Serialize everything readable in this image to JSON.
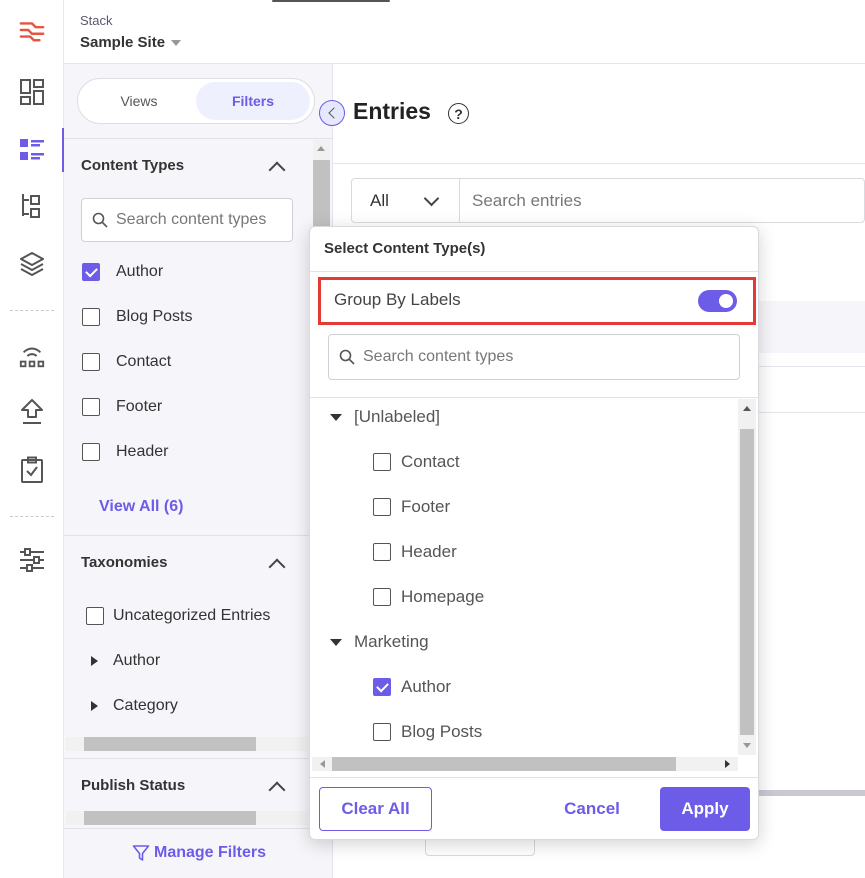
{
  "header": {
    "stack_label": "Stack",
    "site_name": "Sample Site"
  },
  "rail": {
    "icons": [
      "dashboard-icon",
      "entries-icon",
      "content-models-icon",
      "assets-icon",
      "releases-icon",
      "publish-queue-icon",
      "workflows-icon",
      "settings-icon"
    ]
  },
  "filters": {
    "views_label": "Views",
    "filters_label": "Filters",
    "content_types": {
      "title": "Content Types",
      "search_placeholder": "Search content types",
      "items": [
        {
          "label": "Author",
          "checked": true
        },
        {
          "label": "Blog Posts",
          "checked": false
        },
        {
          "label": "Contact",
          "checked": false
        },
        {
          "label": "Footer",
          "checked": false
        },
        {
          "label": "Header",
          "checked": false
        }
      ],
      "view_all": "View All (6)"
    },
    "taxonomies": {
      "title": "Taxonomies",
      "uncategorized": "Uncategorized Entries",
      "items": [
        "Author",
        "Category"
      ]
    },
    "publish_status": {
      "title": "Publish Status"
    },
    "manage_filters": "Manage Filters"
  },
  "main": {
    "title": "Entries",
    "search_scope": "All",
    "search_placeholder": "Search entries"
  },
  "dropdown": {
    "title": "Select Content Type(s)",
    "group_by_labels": "Group By Labels",
    "group_by_enabled": true,
    "search_placeholder": "Search content types",
    "groups": [
      {
        "name": "[Unlabeled]",
        "items": [
          {
            "label": "Contact",
            "checked": false
          },
          {
            "label": "Footer",
            "checked": false
          },
          {
            "label": "Header",
            "checked": false
          },
          {
            "label": "Homepage",
            "checked": false
          }
        ]
      },
      {
        "name": "Marketing",
        "items": [
          {
            "label": "Author",
            "checked": true
          },
          {
            "label": "Blog Posts",
            "checked": false
          }
        ]
      }
    ],
    "clear_all": "Clear All",
    "cancel": "Cancel",
    "apply": "Apply"
  },
  "colors": {
    "accent": "#6c5ce7",
    "highlight": "#e53935"
  }
}
